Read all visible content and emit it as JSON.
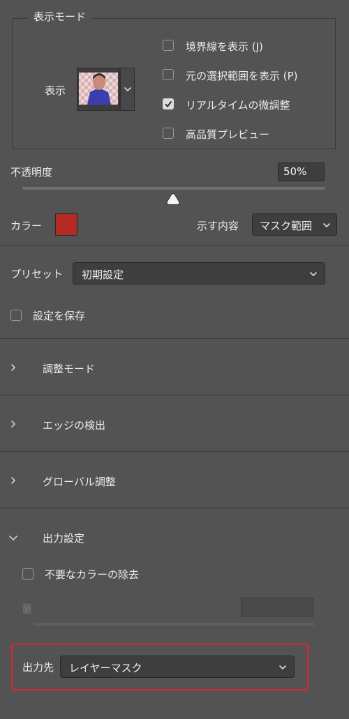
{
  "view_mode": {
    "legend": "表示モード",
    "view_label": "表示",
    "options": [
      {
        "label": "境界線を表示 (J)",
        "checked": false
      },
      {
        "label": "元の選択範囲を表示 (P)",
        "checked": false
      },
      {
        "label": "リアルタイムの微調整",
        "checked": true
      },
      {
        "label": "高品質プレビュー",
        "checked": false
      }
    ]
  },
  "opacity": {
    "label": "不透明度",
    "value": "50%",
    "fraction": 0.5
  },
  "color": {
    "label": "カラー",
    "swatch": "#b62a24",
    "indicate_label": "示す内容",
    "indicate_value": "マスク範囲"
  },
  "preset": {
    "label": "プリセット",
    "value": "初期設定",
    "save_label": "設定を保存",
    "save_checked": false
  },
  "sections": {
    "adjust_mode": "調整モード",
    "edge_detection": "エッジの検出",
    "global_adjust": "グローバル調整",
    "output_settings": "出力設定"
  },
  "output": {
    "decontaminate_label": "不要なカラーの除去",
    "decontaminate_checked": false,
    "amount_label": "量",
    "amount_value": "",
    "output_to_label": "出力先",
    "output_to_value": "レイヤーマスク"
  },
  "colors": {
    "background": "#535353",
    "highlight": "#d22a2a"
  }
}
